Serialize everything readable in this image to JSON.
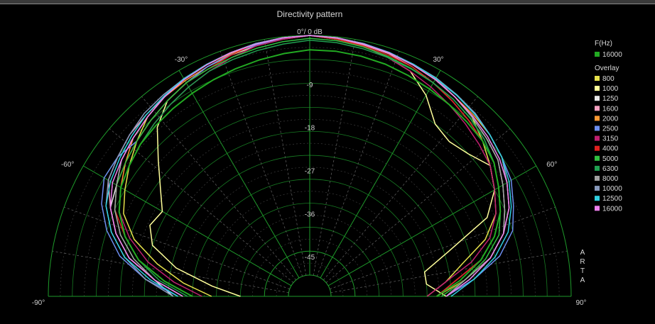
{
  "chart_data": {
    "type": "polar",
    "title": "Directivity pattern",
    "radial_labels": [
      "0°/ 0 dB",
      "-9",
      "-18",
      "-27",
      "-36",
      "-45"
    ],
    "radial_values_db": [
      0,
      -9,
      -18,
      -27,
      -36,
      -45
    ],
    "angle_labels": [
      {
        "angle": -90,
        "text": "-90°"
      },
      {
        "angle": -60,
        "text": "-60°"
      },
      {
        "angle": -30,
        "text": "-30°"
      },
      {
        "angle": 30,
        "text": "30°"
      },
      {
        "angle": 60,
        "text": "60°"
      },
      {
        "angle": 90,
        "text": "90°"
      }
    ],
    "angle_range": [
      -90,
      90
    ],
    "radial_range_db": [
      -50,
      0
    ],
    "grid": true,
    "watermark": "ARTA",
    "legend": {
      "heading": "F(Hz)",
      "current": {
        "name": "16000",
        "color": "#22aa22"
      },
      "overlay_heading": "Overlay",
      "entries": [
        {
          "name": "800",
          "color": "#e4e04a"
        },
        {
          "name": "1000",
          "color": "#ffff9a"
        },
        {
          "name": "1250",
          "color": "#e8e8e8"
        },
        {
          "name": "1600",
          "color": "#f5a0c0"
        },
        {
          "name": "2000",
          "color": "#ff9933"
        },
        {
          "name": "2500",
          "color": "#6d8ef0"
        },
        {
          "name": "3150",
          "color": "#c02070"
        },
        {
          "name": "4000",
          "color": "#e02020"
        },
        {
          "name": "5000",
          "color": "#30c040"
        },
        {
          "name": "6300",
          "color": "#20a050"
        },
        {
          "name": "8000",
          "color": "#a0a0a0"
        },
        {
          "name": "10000",
          "color": "#8899bb"
        },
        {
          "name": "12500",
          "color": "#30d0e0"
        },
        {
          "name": "16000",
          "color": "#ee80ee"
        }
      ]
    },
    "angles": [
      -90,
      -84,
      -78,
      -72,
      -66,
      -60,
      -54,
      -48,
      -42,
      -36,
      -30,
      -24,
      -18,
      -12,
      -6,
      0,
      6,
      12,
      18,
      24,
      30,
      36,
      42,
      48,
      54,
      60,
      66,
      72,
      78,
      84,
      90
    ],
    "series": [
      {
        "name": "800",
        "color": "#e4e04a",
        "values": [
          -34,
          -28,
          -22,
          -16,
          -12,
          -10,
          -8,
          -6,
          -4,
          -3,
          -2,
          -1.5,
          -1,
          -0.5,
          -0.2,
          0,
          -0.2,
          -0.5,
          -1,
          -1.5,
          -2,
          -3,
          -4,
          -6,
          -8,
          -10,
          -12,
          -16,
          -22,
          -26,
          -30
        ]
      },
      {
        "name": "1000",
        "color": "#ffff9a",
        "values": [
          -40,
          -34,
          -26,
          -20,
          -18,
          -19,
          -16,
          -12,
          -7,
          -4,
          -3,
          -2,
          -1.5,
          -1,
          -0.5,
          0,
          -0.5,
          -1,
          -2,
          -3,
          -6,
          -10,
          -11,
          -10,
          -8,
          -10,
          -14,
          -24,
          -30,
          -30,
          -26
        ]
      },
      {
        "name": "1250",
        "color": "#e8e8e8",
        "values": [
          -26,
          -22,
          -16,
          -12,
          -9,
          -8,
          -6,
          -5,
          -4,
          -3,
          -2,
          -1.5,
          -1,
          -0.5,
          -0.2,
          0,
          -0.3,
          -0.6,
          -1,
          -1.5,
          -2,
          -3,
          -4,
          -5,
          -6,
          -8,
          -10,
          -12,
          -16,
          -22,
          -26
        ]
      },
      {
        "name": "1600",
        "color": "#f5a0c0",
        "values": [
          -28,
          -22,
          -16,
          -12,
          -9,
          -6,
          -5,
          -4,
          -3.5,
          -3,
          -2,
          -1.5,
          -1,
          -0.5,
          -0.2,
          0,
          -0.3,
          -0.8,
          -1.2,
          -2,
          -3,
          -4,
          -5,
          -6,
          -7,
          -9,
          -11,
          -14,
          -18,
          -24,
          -28
        ]
      },
      {
        "name": "2000",
        "color": "#ff9933",
        "values": [
          -30,
          -24,
          -18,
          -14,
          -11,
          -9,
          -7,
          -5,
          -4,
          -3,
          -2.5,
          -2,
          -1.2,
          -0.6,
          -0.2,
          0,
          -0.2,
          -0.6,
          -1,
          -1.6,
          -2.2,
          -3,
          -3.5,
          -4,
          -5,
          -7,
          -9,
          -12,
          -16,
          -22,
          -28
        ]
      },
      {
        "name": "2500",
        "color": "#6d8ef0",
        "values": [
          -27,
          -20,
          -14,
          -10,
          -7,
          -5,
          -5,
          -6,
          -5,
          -4,
          -3,
          -2,
          -1.4,
          -0.8,
          -0.3,
          0,
          -0.2,
          -0.6,
          -1,
          -1.5,
          -2,
          -2.5,
          -3,
          -4,
          -5,
          -6,
          -8,
          -10,
          -14,
          -20,
          -26
        ]
      },
      {
        "name": "3150",
        "color": "#c02070",
        "values": [
          -32,
          -26,
          -20,
          -15,
          -11,
          -9,
          -8,
          -7,
          -6,
          -5,
          -4,
          -3,
          -2,
          -1,
          -0.5,
          0,
          -0.5,
          -1,
          -2,
          -3,
          -4,
          -5,
          -6,
          -7,
          -8,
          -10,
          -12,
          -15,
          -20,
          -26,
          -30
        ]
      },
      {
        "name": "4000",
        "color": "#e02020",
        "values": [
          -30,
          -24,
          -18,
          -14,
          -10,
          -8,
          -7,
          -6,
          -5,
          -4,
          -3,
          -2.5,
          -1.5,
          -0.5,
          -0.2,
          0,
          -0.5,
          -1,
          -1.5,
          -2,
          -3,
          -4,
          -5,
          -6,
          -7,
          -9,
          -11,
          -14,
          -18,
          -24,
          -28
        ]
      },
      {
        "name": "5000",
        "color": "#30c040",
        "values": [
          -28,
          -22,
          -17,
          -13,
          -10,
          -8,
          -7,
          -6,
          -5,
          -4,
          -3,
          -2.5,
          -2,
          -1.5,
          -1,
          -0.6,
          -0.8,
          -1.2,
          -1.8,
          -2.4,
          -3,
          -3.6,
          -4.4,
          -5.5,
          -7,
          -9,
          -11,
          -13,
          -17,
          -22,
          -27
        ]
      },
      {
        "name": "6300",
        "color": "#20a050",
        "values": [
          -29,
          -23,
          -18,
          -14,
          -11,
          -9,
          -8,
          -7,
          -6,
          -5,
          -4,
          -3,
          -2.5,
          -2,
          -1.5,
          -1,
          -1.2,
          -1.6,
          -2,
          -2.5,
          -3,
          -3.6,
          -4.5,
          -5.5,
          -7,
          -9,
          -11,
          -14,
          -18,
          -23,
          -28
        ]
      },
      {
        "name": "8000",
        "color": "#a0a0a0",
        "values": [
          -28,
          -22,
          -17,
          -13,
          -10,
          -8,
          -6,
          -5,
          -4,
          -3,
          -2,
          -1.5,
          -1,
          -0.5,
          -0.2,
          0,
          -0.3,
          -0.6,
          -1,
          -1.5,
          -2,
          -3,
          -4,
          -5,
          -6,
          -8,
          -10,
          -12,
          -16,
          -22,
          -26
        ]
      },
      {
        "name": "10000",
        "color": "#8899bb",
        "values": [
          -26,
          -20,
          -15,
          -11,
          -8,
          -6,
          -5,
          -4,
          -3,
          -2.5,
          -2,
          -1.5,
          -1,
          -0.6,
          -0.2,
          0,
          -0.2,
          -0.6,
          -1,
          -1.4,
          -1.8,
          -2.4,
          -3,
          -4,
          -5,
          -7,
          -9,
          -12,
          -16,
          -21,
          -26
        ]
      },
      {
        "name": "12500",
        "color": "#30d0e0",
        "values": [
          -27,
          -21,
          -15,
          -11,
          -8,
          -6.5,
          -5.5,
          -4.5,
          -3.5,
          -2.8,
          -2,
          -1.5,
          -1,
          -0.5,
          -0.2,
          0,
          -0.2,
          -0.5,
          -0.9,
          -1.4,
          -1.9,
          -2.5,
          -3.2,
          -4,
          -5,
          -6.5,
          -8.5,
          -11,
          -15,
          -20,
          -25
        ]
      },
      {
        "name": "16000",
        "color": "#ee80ee",
        "values": [
          -28,
          -22,
          -16,
          -12,
          -9,
          -7,
          -6,
          -5,
          -4,
          -3,
          -2.2,
          -1.6,
          -1,
          -0.6,
          -0.2,
          0,
          -0.2,
          -0.6,
          -1,
          -1.6,
          -2.2,
          -3,
          -3.8,
          -4.6,
          -5.6,
          -7,
          -9,
          -12,
          -16,
          -21,
          -26
        ]
      }
    ],
    "current_series": {
      "name": "16000",
      "color": "#22aa22",
      "values": [
        -30,
        -24,
        -18,
        -14,
        -11,
        -9,
        -8,
        -7,
        -6.5,
        -6,
        -5.5,
        -5,
        -4.5,
        -4,
        -3.5,
        -3,
        -3,
        -3.2,
        -3.5,
        -4,
        -4.5,
        -5,
        -5.5,
        -6,
        -7,
        -9,
        -11,
        -14,
        -18,
        -23,
        -28
      ]
    }
  }
}
